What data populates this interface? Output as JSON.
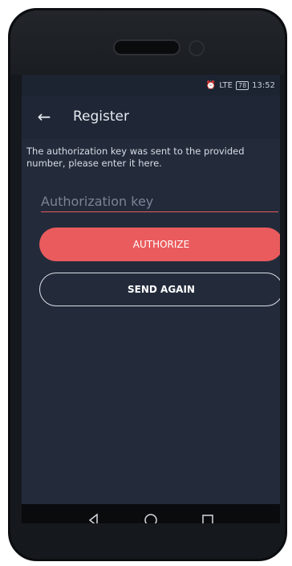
{
  "status": {
    "time": "13:52",
    "battery": "78",
    "signal": "LTE"
  },
  "appbar": {
    "title": "Register",
    "back_icon": "arrow-left-icon"
  },
  "content": {
    "message": "The authorization key was sent to the provided number, please enter it here.",
    "auth_key_placeholder": "Authorization key"
  },
  "buttons": {
    "authorize_label": "AUTHORIZE",
    "send_again_label": "SEND AGAIN"
  },
  "colors": {
    "accent": "#ea5b5d",
    "background": "#232b3b",
    "appbar": "#1f2736"
  },
  "nav": {
    "back_icon": "triangle-back-icon",
    "home_icon": "circle-home-icon",
    "recents_icon": "square-recents-icon"
  }
}
